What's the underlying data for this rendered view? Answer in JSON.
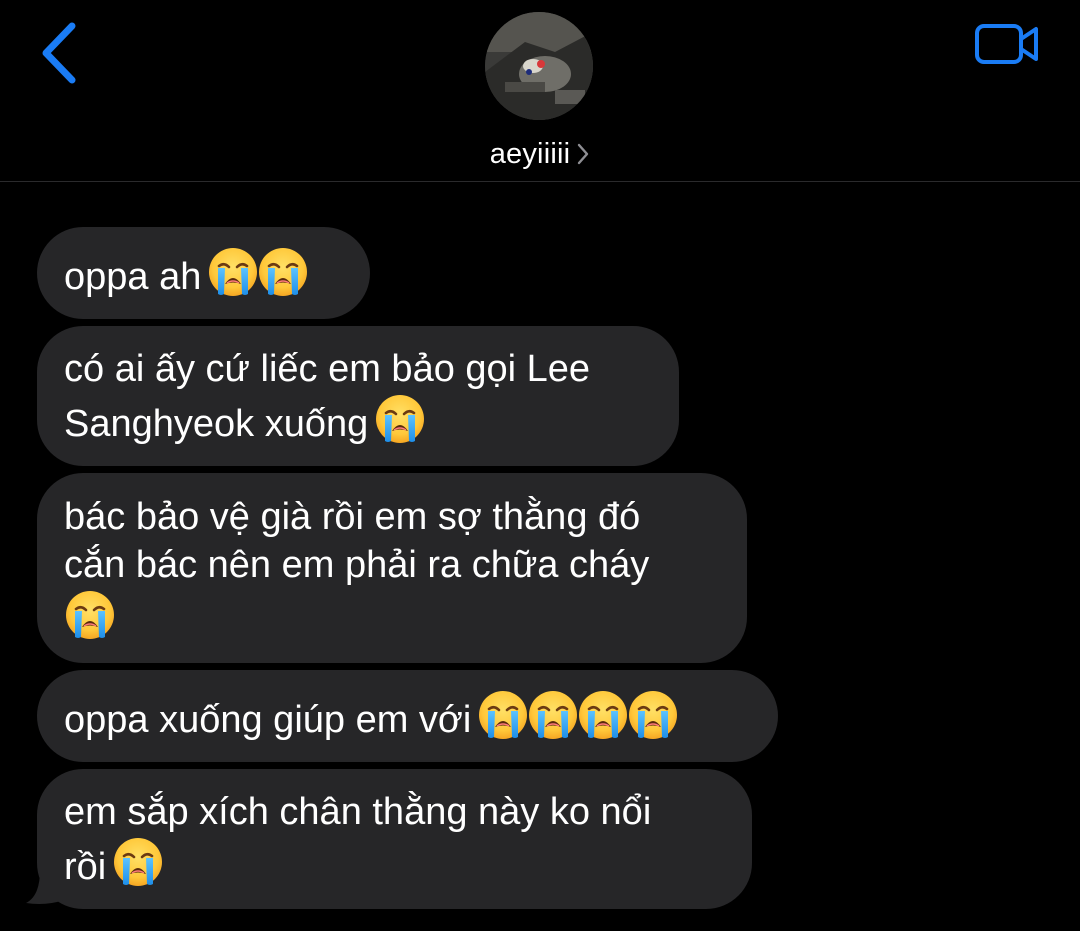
{
  "header": {
    "contact_name": "aeyiiiii",
    "back_icon": "chevron-left-icon",
    "video_icon": "video-camera-icon",
    "accent_color": "#1a7cf5"
  },
  "messages": [
    {
      "lines": [
        "oppa ah"
      ],
      "emoji_count": 2
    },
    {
      "lines": [
        "có ai ấy cứ liếc em bảo gọi Lee",
        "Sanghyeok xuống"
      ],
      "emoji_count": 1
    },
    {
      "lines": [
        "bác bảo vệ già rồi em sợ thằng đó",
        "cắn bác nên em phải ra chữa cháy"
      ],
      "emoji_count": 1,
      "emoji_own_line": true
    },
    {
      "lines": [
        "oppa xuống giúp em với"
      ],
      "emoji_count": 4
    },
    {
      "lines": [
        "em sắp xích chân thằng này ko nổi",
        "rồi"
      ],
      "emoji_count": 1
    }
  ],
  "colors": {
    "background": "#000000",
    "bubble": "#262628",
    "text": "#ffffff"
  }
}
